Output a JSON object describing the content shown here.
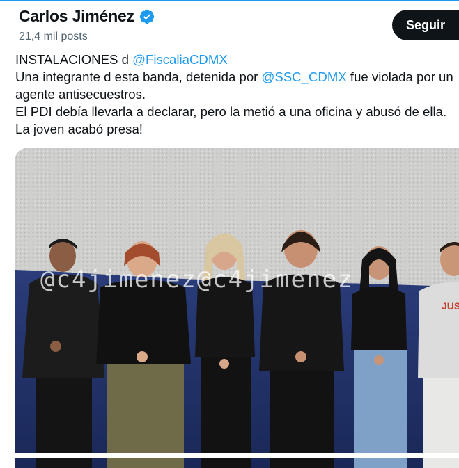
{
  "author": {
    "name": "Carlos Jiménez",
    "posts": "21,4 mil posts",
    "verified_color": "#1d9bf0"
  },
  "follow_button": {
    "label": "Seguir"
  },
  "tweet": {
    "line1_prefix": "INSTALACIONES d ",
    "line1_mention": "@FiscaliaCDMX",
    "line2_prefix": "Una integrante d esta banda, detenida por ",
    "line2_mention": "@SSC_CDMX",
    "line2_suffix": " fue violada por un",
    "line3": "agente antisecuestros.",
    "line4": "El PDI debía llevarla a declarar, pero la metió a una oficina y abusó de ella.",
    "line5": "La joven acabó presa!"
  },
  "photo": {
    "watermark": "@c4jimenez@c4jimenez",
    "shirt_text": "JUS"
  },
  "colors": {
    "accent": "#1d9bf0",
    "text": "#0f1419",
    "secondary": "#536471",
    "button": "#0f1419"
  }
}
